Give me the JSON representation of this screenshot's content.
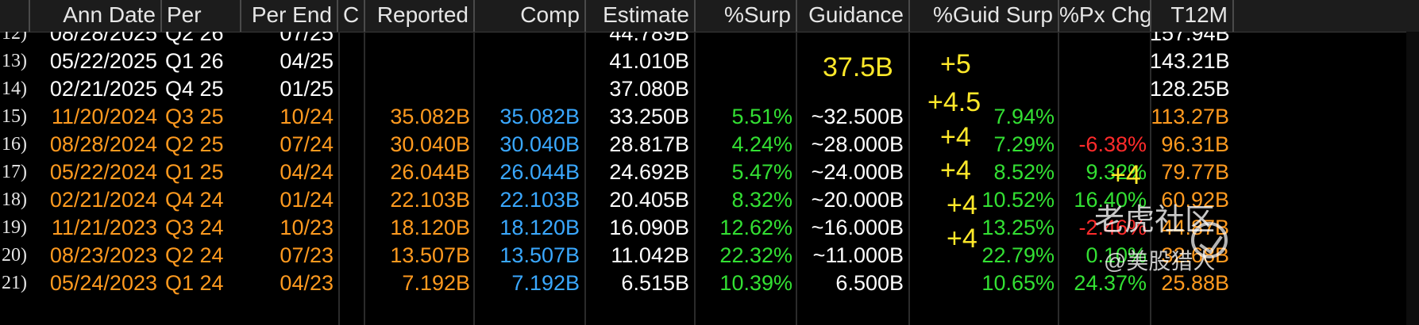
{
  "columns": [
    {
      "key": "ann_date",
      "label": "Ann Date"
    },
    {
      "key": "per",
      "label": "Per"
    },
    {
      "key": "per_end",
      "label": "Per End"
    },
    {
      "key": "c",
      "label": "C"
    },
    {
      "key": "reported",
      "label": "Reported"
    },
    {
      "key": "comp",
      "label": "Comp"
    },
    {
      "key": "estimate",
      "label": "Estimate"
    },
    {
      "key": "surp",
      "label": "%Surp"
    },
    {
      "key": "guidance",
      "label": "Guidance"
    },
    {
      "key": "guid_surp",
      "label": "%Guid Surp"
    },
    {
      "key": "px_chg",
      "label": "%Px Chg"
    },
    {
      "key": "t12m",
      "label": "T12M"
    }
  ],
  "rows": [
    {
      "num": "12)",
      "ann_date": "08/28/2025",
      "per": "Q2 26",
      "per_end": "07/25",
      "reported": "",
      "comp": "",
      "estimate": "44.789B",
      "surp": "",
      "guidance": "",
      "guid_surp": "",
      "px_chg": "",
      "t12m": "157.94B",
      "style": "white"
    },
    {
      "num": "13)",
      "ann_date": "05/22/2025",
      "per": "Q1 26",
      "per_end": "04/25",
      "reported": "",
      "comp": "",
      "estimate": "41.010B",
      "surp": "",
      "guidance": "",
      "guid_surp": "",
      "px_chg": "",
      "t12m": "143.21B",
      "style": "white"
    },
    {
      "num": "14)",
      "ann_date": "02/21/2025",
      "per": "Q4 25",
      "per_end": "01/25",
      "reported": "",
      "comp": "",
      "estimate": "37.080B",
      "surp": "",
      "guidance": "",
      "guid_surp": "",
      "px_chg": "",
      "t12m": "128.25B",
      "style": "white"
    },
    {
      "num": "15)",
      "ann_date": "11/20/2024",
      "per": "Q3 25",
      "per_end": "10/24",
      "reported": "35.082B",
      "comp": "35.082B",
      "estimate": "33.250B",
      "surp": "5.51%",
      "guidance": "~32.500B",
      "guid_surp": "7.94%",
      "px_chg": "",
      "t12m": "113.27B",
      "style": "orange"
    },
    {
      "num": "16)",
      "ann_date": "08/28/2024",
      "per": "Q2 25",
      "per_end": "07/24",
      "reported": "30.040B",
      "comp": "30.040B",
      "estimate": "28.817B",
      "surp": "4.24%",
      "guidance": "~28.000B",
      "guid_surp": "7.29%",
      "px_chg": "-6.38%",
      "t12m": "96.31B",
      "style": "orange"
    },
    {
      "num": "17)",
      "ann_date": "05/22/2024",
      "per": "Q1 25",
      "per_end": "04/24",
      "reported": "26.044B",
      "comp": "26.044B",
      "estimate": "24.692B",
      "surp": "5.47%",
      "guidance": "~24.000B",
      "guid_surp": "8.52%",
      "px_chg": "9.32%",
      "t12m": "79.77B",
      "style": "orange"
    },
    {
      "num": "18)",
      "ann_date": "02/21/2024",
      "per": "Q4 24",
      "per_end": "01/24",
      "reported": "22.103B",
      "comp": "22.103B",
      "estimate": "20.405B",
      "surp": "8.32%",
      "guidance": "~20.000B",
      "guid_surp": "10.52%",
      "px_chg": "16.40%",
      "t12m": "60.92B",
      "style": "orange"
    },
    {
      "num": "19)",
      "ann_date": "11/21/2023",
      "per": "Q3 24",
      "per_end": "10/23",
      "reported": "18.120B",
      "comp": "18.120B",
      "estimate": "16.090B",
      "surp": "12.62%",
      "guidance": "~16.000B",
      "guid_surp": "13.25%",
      "px_chg": "-2.46%",
      "t12m": "44.87B",
      "style": "orange"
    },
    {
      "num": "20)",
      "ann_date": "08/23/2023",
      "per": "Q2 24",
      "per_end": "07/23",
      "reported": "13.507B",
      "comp": "13.507B",
      "estimate": "11.042B",
      "surp": "22.32%",
      "guidance": "~11.000B",
      "guid_surp": "22.79%",
      "px_chg": "0.10%",
      "t12m": "32.68B",
      "style": "orange"
    },
    {
      "num": "21)",
      "ann_date": "05/24/2023",
      "per": "Q1 24",
      "per_end": "04/23",
      "reported": "7.192B",
      "comp": "7.192B",
      "estimate": "6.515B",
      "surp": "10.39%",
      "guidance": "6.500B",
      "guid_surp": "10.65%",
      "px_chg": "24.37%",
      "t12m": "25.88B",
      "style": "orange"
    }
  ],
  "annotations": {
    "guidance_next": "37.5B",
    "a1": "+5",
    "a2": "+4.5",
    "a3": "+4",
    "a4": "+4",
    "a5": "+4",
    "a6": "+4",
    "a7": "+4"
  },
  "watermark": {
    "brand": "老虎社区",
    "handle": "@美股猎人"
  },
  "colors": {
    "orange": "#ff9a1f",
    "blue": "#3aa8ff",
    "green": "#33e033",
    "red": "#ff2b2b",
    "yellow": "#ffe82a",
    "header_bg": "#1c1c1c"
  }
}
